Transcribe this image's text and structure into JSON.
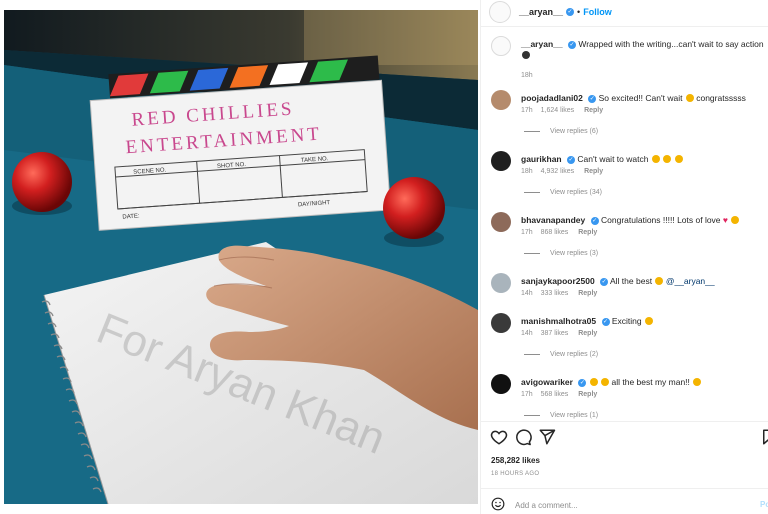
{
  "post": {
    "username": "__aryan__",
    "follow_label": "Follow",
    "dot": "•",
    "caption": {
      "username": "__aryan__",
      "text": "Wrapped with the writing...can't wait to say action",
      "time": "18h"
    },
    "photo": {
      "clapper_line1": "RED CHILLIES",
      "clapper_line2": "ENTERTAINMENT",
      "scene_label": "SCENE NO.",
      "shot_label": "SHOT NO.",
      "take_label": "TAKE NO.",
      "date_label": "DATE:",
      "daynight_label": "DAY/NIGHT",
      "watermark": "For Aryan Khan"
    }
  },
  "comments": [
    {
      "username": "poojadadlani02",
      "text": "So excited!! Can't wait",
      "text2": "congratsssss",
      "time": "17h",
      "likes": "1,624 likes",
      "reply": "Reply",
      "view_replies": "View replies (6)"
    },
    {
      "username": "gaurikhan",
      "text": "Can't wait to watch",
      "time": "18h",
      "likes": "4,932 likes",
      "reply": "Reply",
      "view_replies": "View replies (34)"
    },
    {
      "username": "bhavanapandey",
      "text": "Congratulations !!!!! Lots of love",
      "time": "17h",
      "likes": "868 likes",
      "reply": "Reply",
      "view_replies": "View replies (3)"
    },
    {
      "username": "sanjaykapoor2500",
      "text": "All the best",
      "mention": "@__aryan__",
      "time": "14h",
      "likes": "333 likes",
      "reply": "Reply"
    },
    {
      "username": "manishmalhotra05",
      "text": "Exciting",
      "time": "14h",
      "likes": "387 likes",
      "reply": "Reply",
      "view_replies": "View replies (2)"
    },
    {
      "username": "avigowariker",
      "text": "all the best my man!!",
      "time": "17h",
      "likes": "568 likes",
      "reply": "Reply",
      "view_replies": "View replies (1)"
    }
  ],
  "footer": {
    "likes": "258,282 likes",
    "time_ago": "18 HOURS AGO",
    "comment_placeholder": "Add a comment...",
    "post_label": "Po"
  },
  "icons": {
    "like": "heart-icon",
    "comment": "comment-icon",
    "share": "share-icon",
    "save": "bookmark-icon",
    "emoji": "emoji-icon"
  },
  "colors": {
    "accent": "#0095f6",
    "verified": "#3897f0",
    "muted": "#8e8e8e",
    "table_felt": "#16607a",
    "ball": "#d21f1f"
  }
}
